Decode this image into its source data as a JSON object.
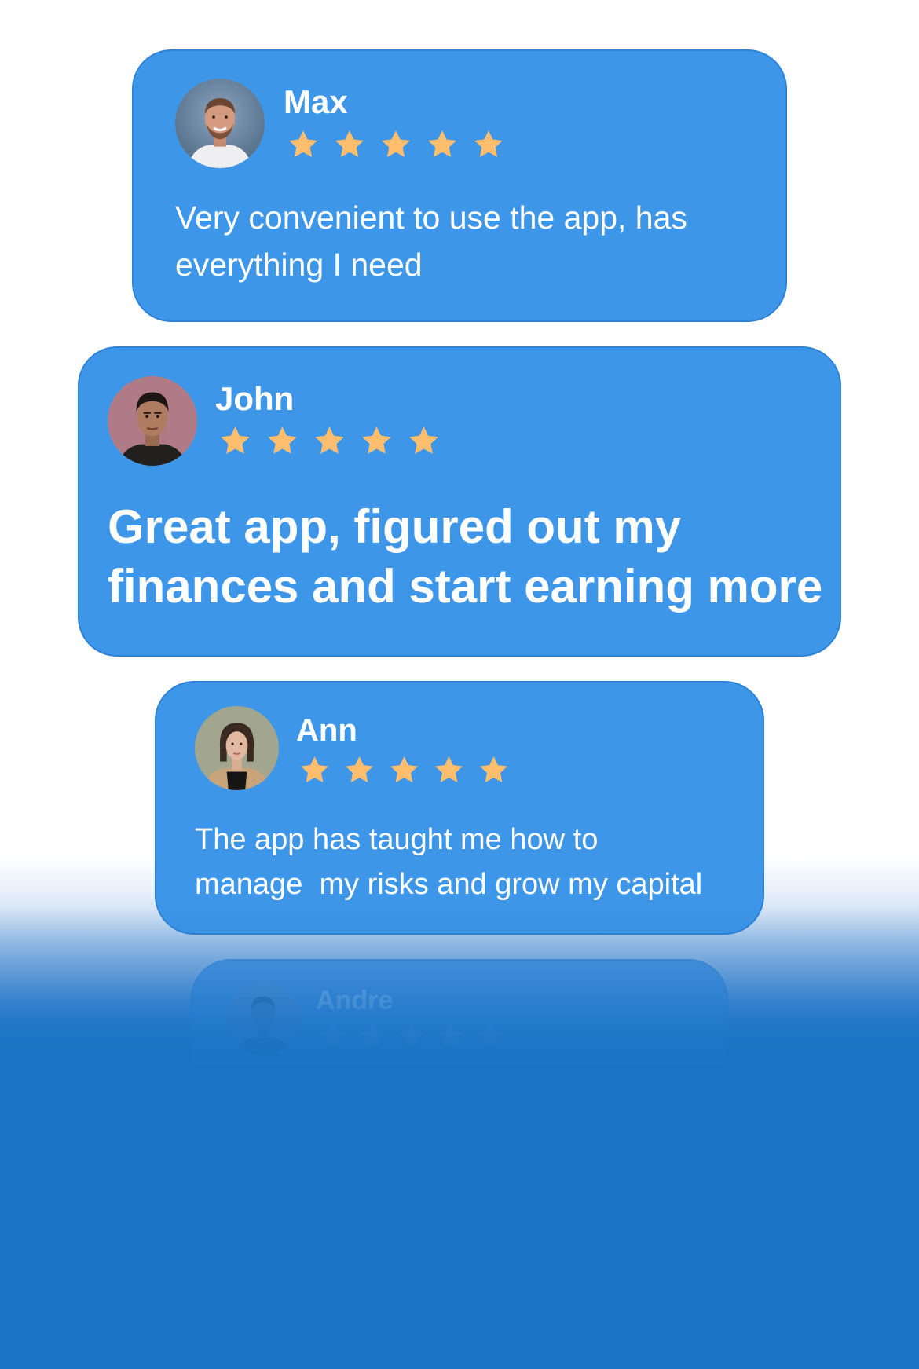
{
  "colors": {
    "card_fill": "#3e96e9",
    "card_border": "#2f83d6",
    "star": "#ffbd6e",
    "bottom_background": "#1b73c5",
    "text": "#ffffff"
  },
  "reviews": [
    {
      "name": "Max",
      "rating": 5,
      "text_lines": [
        "Very convenient to use the app, has",
        "everything I need"
      ],
      "avatar_icon": "man-portrait-avatar"
    },
    {
      "name": "John",
      "rating": 5,
      "text_lines": [
        "Great app, figured out my",
        "finances and start earning more"
      ],
      "avatar_icon": "man-portrait-avatar"
    },
    {
      "name": "Ann",
      "rating": 5,
      "text_lines": [
        "The app has taught me how to",
        "manage  my risks and grow my capital"
      ],
      "avatar_icon": "woman-portrait-avatar"
    },
    {
      "name": "Andre",
      "rating": 5,
      "avatar_icon": "man-portrait-avatar"
    }
  ]
}
